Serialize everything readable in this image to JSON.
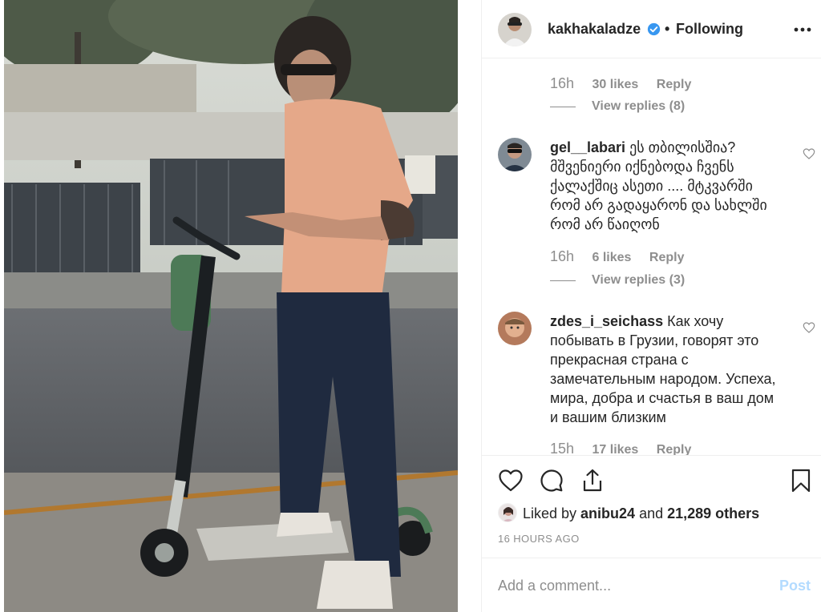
{
  "header": {
    "username": "kakhakaladze",
    "separator": "•",
    "follow_status": "Following"
  },
  "comments": {
    "first_meta": {
      "time": "16h",
      "likes": "30 likes",
      "reply": "Reply",
      "view_replies": "View replies (8)"
    },
    "items": [
      {
        "username": "gel__labari",
        "text": " ეს თბილისშია? მშვენიერი იქნებოდა ჩვენს ქალაქშიც ასეთი .... მტკვარში რომ არ გადაყარონ და სახლში რომ არ წაიღონ",
        "time": "16h",
        "likes": "6 likes",
        "reply": "Reply",
        "view_replies": "View replies (3)"
      },
      {
        "username": "zdes_i_seichass",
        "text": " Как хочу побывать в Грузии, говорят это прекрасная страна с замечательным народом. Успеха, мира, добра и счастья в ваш дом и вашим близким",
        "time": "15h",
        "likes": "17 likes",
        "reply": "Reply"
      }
    ]
  },
  "actions": {
    "liked_by_prefix": "Liked by ",
    "liked_by_user": "anibu24",
    "liked_by_middle": " and ",
    "liked_by_count": "21,289 others",
    "time_ago": "16 HOURS AGO"
  },
  "add_comment": {
    "placeholder": "Add a comment...",
    "post_label": "Post"
  },
  "colors": {
    "text": "#262626",
    "secondary": "#8e8e8e",
    "verified": "#3897f0",
    "post_disabled": "#b3dbff",
    "border": "#efefef"
  }
}
